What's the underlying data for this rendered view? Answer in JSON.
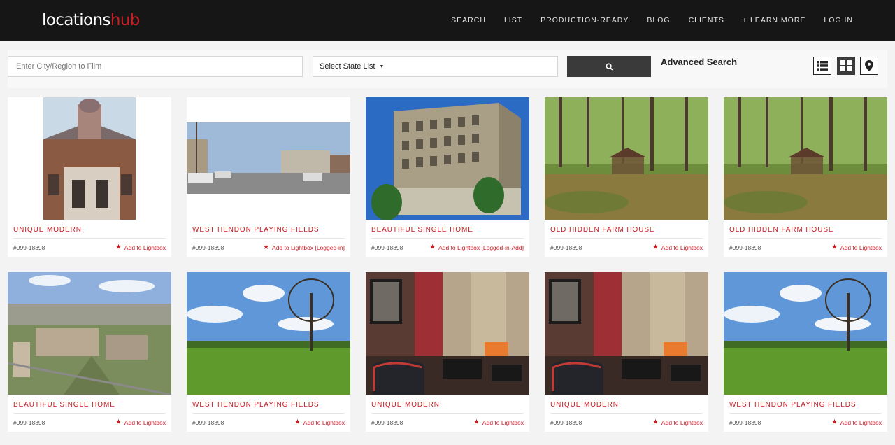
{
  "brand": {
    "part1": "locations",
    "part2": "hub"
  },
  "nav": [
    "SEARCH",
    "LIST",
    "PRODUCTION-READY",
    "BLOG",
    "CLIENTS",
    "+ LEARN MORE",
    "LOG IN"
  ],
  "search": {
    "city_placeholder": "Enter City/Region to Film",
    "state_label": "Select State List",
    "advanced": "Advanced Search"
  },
  "colors": {
    "accent": "#c71f25",
    "header_bg": "#161616"
  },
  "cards": [
    {
      "title": "UNIQUE MODERN",
      "code": "#999-18398",
      "lightbox": "Add to Lightbox",
      "image": "victorian-building"
    },
    {
      "title": "WEST HENDON PLAYING FIELDS",
      "code": "#999-18398",
      "lightbox": "Add to Lightbox [Logged-in]",
      "image": "street-cars"
    },
    {
      "title": "BEAUTIFUL SINGLE HOME",
      "code": "#999-18398",
      "lightbox": "Add to Lightbox [Logged-in-Add]",
      "image": "tall-building"
    },
    {
      "title": "OLD HIDDEN FARM HOUSE",
      "code": "#999-18398",
      "lightbox": "Add to Lightbox",
      "image": "forest-gazebo"
    },
    {
      "title": "OLD HIDDEN FARM HOUSE",
      "code": "#999-18398",
      "lightbox": "Add to Lightbox",
      "image": "forest-gazebo"
    },
    {
      "title": "BEAUTIFUL SINGLE HOME",
      "code": "#999-18398",
      "lightbox": "Add to Lightbox",
      "image": "city-aerial"
    },
    {
      "title": "WEST HENDON PLAYING FIELDS",
      "code": "#999-18398",
      "lightbox": "Add to Lightbox",
      "image": "park-tree"
    },
    {
      "title": "UNIQUE MODERN",
      "code": "#999-18398",
      "lightbox": "Add to Lightbox",
      "image": "lounge-interior"
    },
    {
      "title": "UNIQUE MODERN",
      "code": "#999-18398",
      "lightbox": "Add to Lightbox",
      "image": "lounge-interior"
    },
    {
      "title": "WEST HENDON PLAYING FIELDS",
      "code": "#999-18398",
      "lightbox": "Add to Lightbox",
      "image": "park-tree"
    }
  ]
}
